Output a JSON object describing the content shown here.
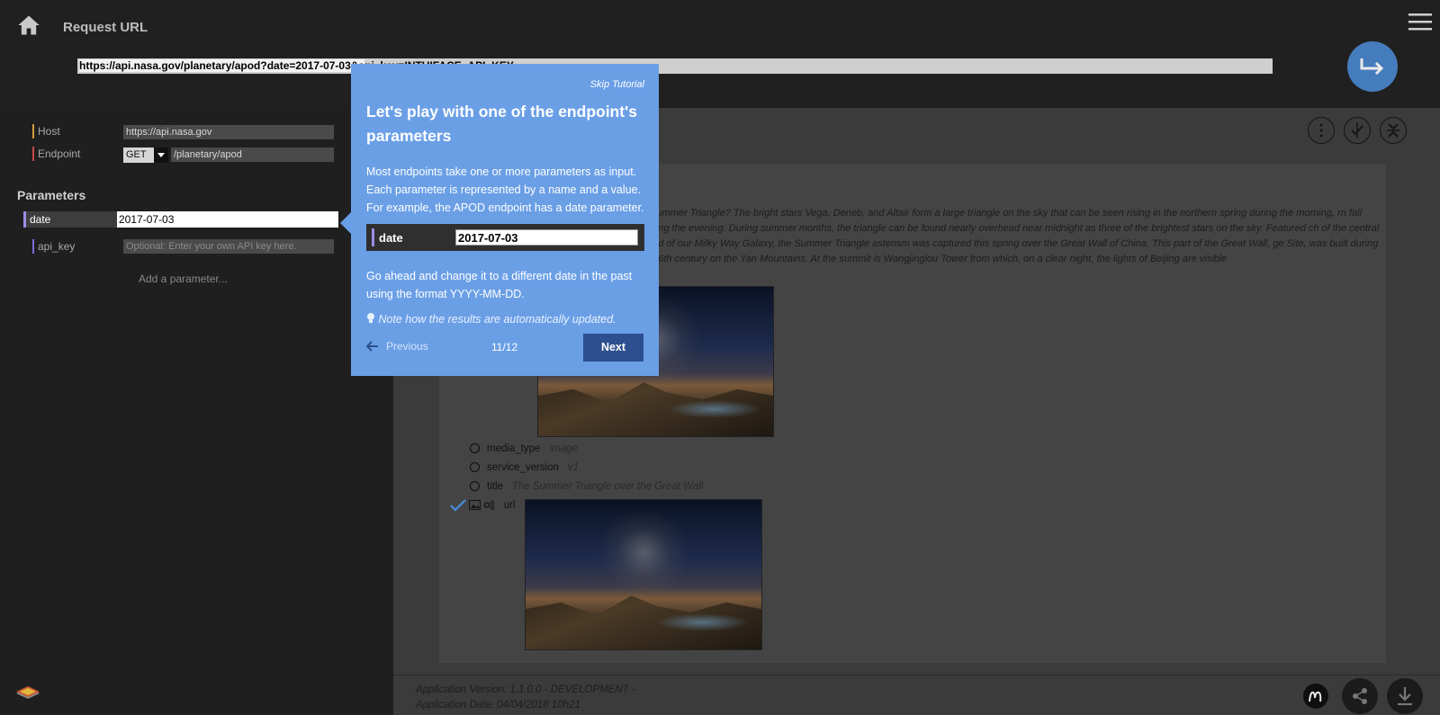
{
  "header": {
    "title": "Request URL",
    "url_prefix": "https://api.nasa.gov/planetary/apod?date=2017-07-03&a",
    "url_suffix": "pi_key=INTUIFACE_API_KEY"
  },
  "request": {
    "host_label": "Host",
    "host_value": "https://api.nasa.gov",
    "endpoint_label": "Endpoint",
    "method": "GET",
    "endpoint_value": "/planetary/apod"
  },
  "parameters": {
    "title": "Parameters",
    "date_label": "date",
    "date_value": "2017-07-03",
    "api_key_label": "api_key",
    "api_key_placeholder": "Optional: Enter your own API key here.",
    "add_label": "Add a parameter..."
  },
  "results": {
    "description": "e Summer Triangle? The bright stars Vega, Deneb, and Altair form a large triangle on the sky that can be seen rising in the northern spring during the morning, rn fall during the evening. During summer months, the triangle can be found nearly overhead near midnight as three of the brightest stars on the sky. Featured ch of the central band of our Milky Way Galaxy, the Summer Triangle asterism was captured this spring over the Great Wall of China. This part of the Great Wall, ge Site, was built during the 6th century on the Yan Mountains. At the summit is Wangjinglou Tower from which, on a clear night, the lights of Beijing are visible",
    "rows": [
      {
        "key": "media_type",
        "value": "image"
      },
      {
        "key": "service_version",
        "value": "v1"
      },
      {
        "key": "title",
        "value": "The Summer Triangle over the Great Wall"
      },
      {
        "key": "url",
        "value": ""
      }
    ]
  },
  "footer": {
    "version": "Application Version: 1.1.0.0 - DEVELOPMENT -",
    "date": "Application Date: 04/04/2018 10h21"
  },
  "tutorial": {
    "skip": "Skip Tutorial",
    "title": "Let's play with one of the endpoint's parameters",
    "intro": "Most endpoints take one or more parameters as input. Each parameter is represented by a name and a value. For example, the APOD endpoint has a date parameter.",
    "demo_label": "date",
    "demo_value": "2017-07-03",
    "instruction": "Go ahead and change it to a different date in the past using the format YYYY-MM-DD.",
    "note": "Note how the results are automatically updated.",
    "previous": "Previous",
    "progress": "11/12",
    "next": "Next"
  },
  "colors": {
    "accent": "#6a9fe6",
    "next_button": "#2c4f8f",
    "param_bar": "#9b8de8"
  }
}
